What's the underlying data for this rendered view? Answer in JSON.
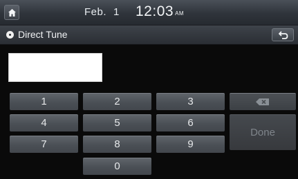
{
  "status_bar": {
    "date_month": "Feb.",
    "date_day": "1",
    "time": "12:03",
    "ampm": "AM"
  },
  "title_bar": {
    "title": "Direct Tune"
  },
  "input": {
    "value": ""
  },
  "keypad": {
    "keys": [
      "1",
      "2",
      "3",
      "4",
      "5",
      "6",
      "7",
      "8",
      "9",
      "0"
    ],
    "done_label": "Done"
  },
  "icons": {
    "home": "home-icon",
    "back": "back-icon",
    "backspace": "backspace-icon",
    "radio": "radio-dot-icon"
  }
}
